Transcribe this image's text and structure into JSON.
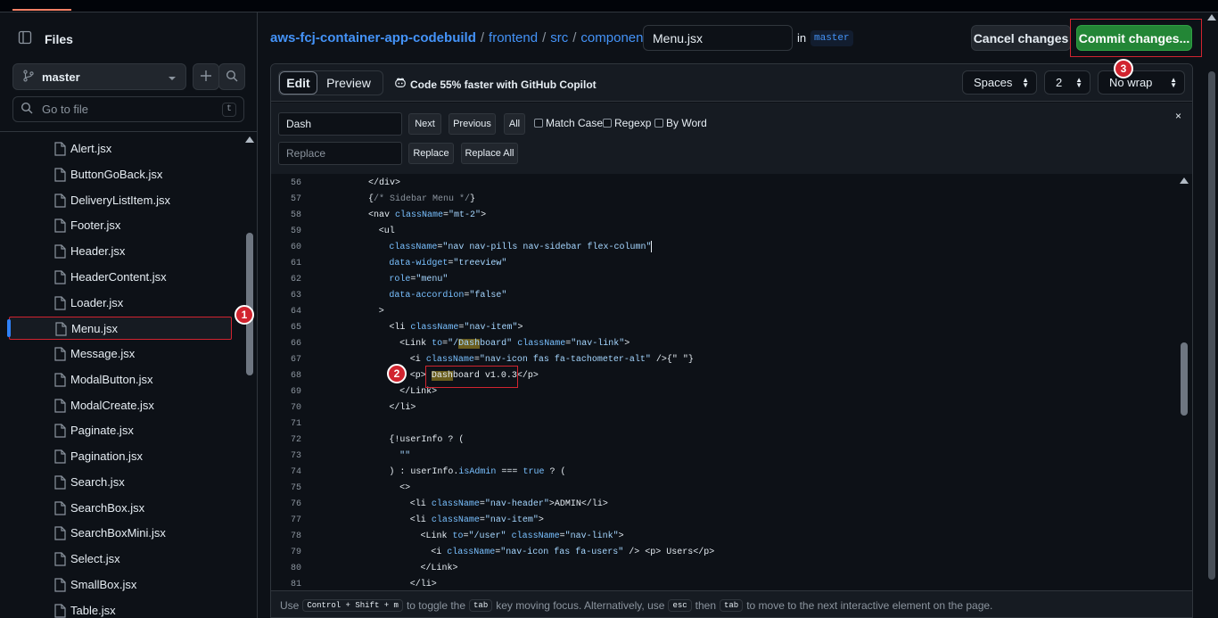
{
  "sidebar": {
    "title": "Files",
    "branch": "master",
    "goto_placeholder": "Go to file",
    "goto_shortcut": "t",
    "files": [
      "Alert.jsx",
      "ButtonGoBack.jsx",
      "DeliveryListItem.jsx",
      "Footer.jsx",
      "Header.jsx",
      "HeaderContent.jsx",
      "Loader.jsx",
      "Menu.jsx",
      "Message.jsx",
      "ModalButton.jsx",
      "ModalCreate.jsx",
      "Paginate.jsx",
      "Pagination.jsx",
      "Search.jsx",
      "SearchBox.jsx",
      "SearchBoxMini.jsx",
      "Select.jsx",
      "SmallBox.jsx",
      "Table.jsx"
    ],
    "active_file": "Menu.jsx"
  },
  "header": {
    "breadcrumb": {
      "repo": "aws-fcj-container-app-codebuild",
      "seg1": "frontend",
      "seg2": "src",
      "seg3": "components",
      "sep": "/"
    },
    "filename": "Menu.jsx",
    "in_label": "in",
    "branch": "master",
    "cancel_label": "Cancel changes",
    "commit_label": "Commit changes..."
  },
  "toolbar": {
    "edit_tab": "Edit",
    "preview_tab": "Preview",
    "copilot_text": "Code 55% faster with GitHub Copilot",
    "indent_mode": "Spaces",
    "indent_size": "2",
    "wrap_mode": "No wrap"
  },
  "find": {
    "search_value": "Dash",
    "next": "Next",
    "previous": "Previous",
    "all": "All",
    "match_case": "Match Case",
    "regexp": "Regexp",
    "by_word": "By Word",
    "replace_placeholder": "Replace",
    "replace": "Replace",
    "replace_all": "Replace All",
    "close": "×"
  },
  "code": {
    "lines": [
      {
        "n": "56",
        "indent": 0,
        "segs": [
          [
            "p",
            "</div>"
          ]
        ]
      },
      {
        "n": "57",
        "indent": 0,
        "segs": [
          [
            "p",
            "{"
          ],
          [
            "c",
            "/* Sidebar Menu */"
          ],
          [
            "p",
            "}"
          ]
        ]
      },
      {
        "n": "58",
        "indent": 0,
        "segs": [
          [
            "p",
            "<nav "
          ],
          [
            "k",
            "className"
          ],
          [
            "p",
            "="
          ],
          [
            "s",
            "\"mt-2\""
          ],
          [
            "p",
            ">"
          ]
        ]
      },
      {
        "n": "59",
        "indent": 1,
        "segs": [
          [
            "p",
            "<ul"
          ]
        ]
      },
      {
        "n": "60",
        "indent": 2,
        "segs": [
          [
            "k",
            "className"
          ],
          [
            "p",
            "="
          ],
          [
            "s",
            "\"nav nav-pills nav-sidebar flex-column\""
          ],
          [
            "cur",
            ""
          ]
        ]
      },
      {
        "n": "61",
        "indent": 2,
        "segs": [
          [
            "k",
            "data-widget"
          ],
          [
            "p",
            "="
          ],
          [
            "s",
            "\"treeview\""
          ]
        ]
      },
      {
        "n": "62",
        "indent": 2,
        "segs": [
          [
            "k",
            "role"
          ],
          [
            "p",
            "="
          ],
          [
            "s",
            "\"menu\""
          ]
        ]
      },
      {
        "n": "63",
        "indent": 2,
        "segs": [
          [
            "k",
            "data-accordion"
          ],
          [
            "p",
            "="
          ],
          [
            "s",
            "\"false\""
          ]
        ]
      },
      {
        "n": "64",
        "indent": 1,
        "segs": [
          [
            "p",
            ">"
          ]
        ]
      },
      {
        "n": "65",
        "indent": 2,
        "segs": [
          [
            "p",
            "<li "
          ],
          [
            "k",
            "className"
          ],
          [
            "p",
            "="
          ],
          [
            "s",
            "\"nav-item\""
          ],
          [
            "p",
            ">"
          ]
        ]
      },
      {
        "n": "66",
        "indent": 3,
        "segs": [
          [
            "p",
            "<Link "
          ],
          [
            "k",
            "to"
          ],
          [
            "p",
            "="
          ],
          [
            "s",
            "\"/"
          ],
          [
            "hs",
            "Dash"
          ],
          [
            "s",
            "board\""
          ],
          [
            "p",
            " "
          ],
          [
            "k",
            "className"
          ],
          [
            "p",
            "="
          ],
          [
            "s",
            "\"nav-link\""
          ],
          [
            "p",
            ">"
          ]
        ]
      },
      {
        "n": "67",
        "indent": 4,
        "segs": [
          [
            "p",
            "<i "
          ],
          [
            "k",
            "className"
          ],
          [
            "p",
            "="
          ],
          [
            "s",
            "\"nav-icon fas fa-tachometer-alt\""
          ],
          [
            "p",
            " />{\" \"}"
          ]
        ]
      },
      {
        "n": "68",
        "indent": 4,
        "segs": [
          [
            "p",
            "<p> "
          ],
          [
            "h",
            "Dash"
          ],
          [
            "p",
            "board v1.0.3</p>"
          ]
        ]
      },
      {
        "n": "69",
        "indent": 3,
        "segs": [
          [
            "p",
            "</Link>"
          ]
        ]
      },
      {
        "n": "70",
        "indent": 2,
        "segs": [
          [
            "p",
            "</li>"
          ]
        ]
      },
      {
        "n": "71",
        "indent": 0,
        "segs": []
      },
      {
        "n": "72",
        "indent": 2,
        "segs": [
          [
            "p",
            "{!userInfo ? ("
          ]
        ]
      },
      {
        "n": "73",
        "indent": 3,
        "segs": [
          [
            "s",
            "\"\""
          ]
        ]
      },
      {
        "n": "74",
        "indent": 2,
        "segs": [
          [
            "p",
            ") : userInfo."
          ],
          [
            "k",
            "isAdmin"
          ],
          [
            "p",
            " === "
          ],
          [
            "k",
            "true"
          ],
          [
            "p",
            " ? ("
          ]
        ]
      },
      {
        "n": "75",
        "indent": 3,
        "segs": [
          [
            "p",
            "<>"
          ]
        ]
      },
      {
        "n": "76",
        "indent": 4,
        "segs": [
          [
            "p",
            "<li "
          ],
          [
            "k",
            "className"
          ],
          [
            "p",
            "="
          ],
          [
            "s",
            "\"nav-header\""
          ],
          [
            "p",
            ">ADMIN</li>"
          ]
        ]
      },
      {
        "n": "77",
        "indent": 4,
        "segs": [
          [
            "p",
            "<li "
          ],
          [
            "k",
            "className"
          ],
          [
            "p",
            "="
          ],
          [
            "s",
            "\"nav-item\""
          ],
          [
            "p",
            ">"
          ]
        ]
      },
      {
        "n": "78",
        "indent": 5,
        "segs": [
          [
            "p",
            "<Link "
          ],
          [
            "k",
            "to"
          ],
          [
            "p",
            "="
          ],
          [
            "s",
            "\"/user\""
          ],
          [
            "p",
            " "
          ],
          [
            "k",
            "className"
          ],
          [
            "p",
            "="
          ],
          [
            "s",
            "\"nav-link\""
          ],
          [
            "p",
            ">"
          ]
        ]
      },
      {
        "n": "79",
        "indent": 6,
        "segs": [
          [
            "p",
            "<i "
          ],
          [
            "k",
            "className"
          ],
          [
            "p",
            "="
          ],
          [
            "s",
            "\"nav-icon fas fa-users\""
          ],
          [
            "p",
            " /> <p> Users</p>"
          ]
        ]
      },
      {
        "n": "80",
        "indent": 5,
        "segs": [
          [
            "p",
            "</Link>"
          ]
        ]
      },
      {
        "n": "81",
        "indent": 4,
        "segs": [
          [
            "p",
            "</li>"
          ]
        ]
      }
    ]
  },
  "footer": {
    "use": "Use",
    "key1": "Control + Shift + m",
    "text1": "to toggle the",
    "key2": "tab",
    "text2": "key moving focus. Alternatively, use",
    "key3": "esc",
    "text3": "then",
    "key4": "tab",
    "text4": "to move to the next interactive element on the page."
  },
  "annotations": {
    "b1": "1",
    "b2": "2",
    "b3": "3"
  },
  "colors": {
    "accent_blue": "#4493f8",
    "commit_green": "#238636",
    "annotation_red": "#d1242f",
    "search_highlight": "#6b5e1e"
  }
}
